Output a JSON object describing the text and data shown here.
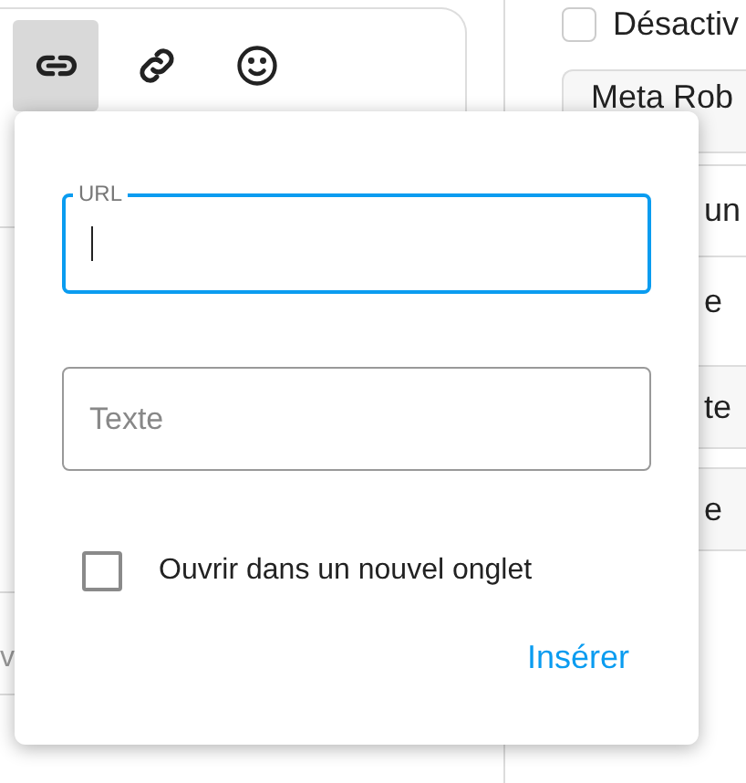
{
  "editor": {
    "toolbar": [
      {
        "kind": "link",
        "selected": true
      },
      {
        "kind": "unlink",
        "selected": false
      },
      {
        "kind": "emoji",
        "selected": false
      }
    ],
    "fragment": "v"
  },
  "sidebar": {
    "checkbox": {
      "label": "Désactiv",
      "checked": false
    },
    "button": "Meta Rob",
    "rows": [
      {
        "kind": "plain",
        "text": "un"
      },
      {
        "kind": "plain",
        "text": "e"
      },
      {
        "kind": "boxed",
        "text": "te"
      },
      {
        "kind": "boxed",
        "text": "e"
      }
    ]
  },
  "link_popover": {
    "url_field": {
      "label": "URL",
      "focused": true
    },
    "text_field": {
      "placeholder": "Texte"
    },
    "new_tab": {
      "label": "Ouvrir dans un nouvel onglet",
      "checked": false
    },
    "insert_button": "Insérer"
  }
}
